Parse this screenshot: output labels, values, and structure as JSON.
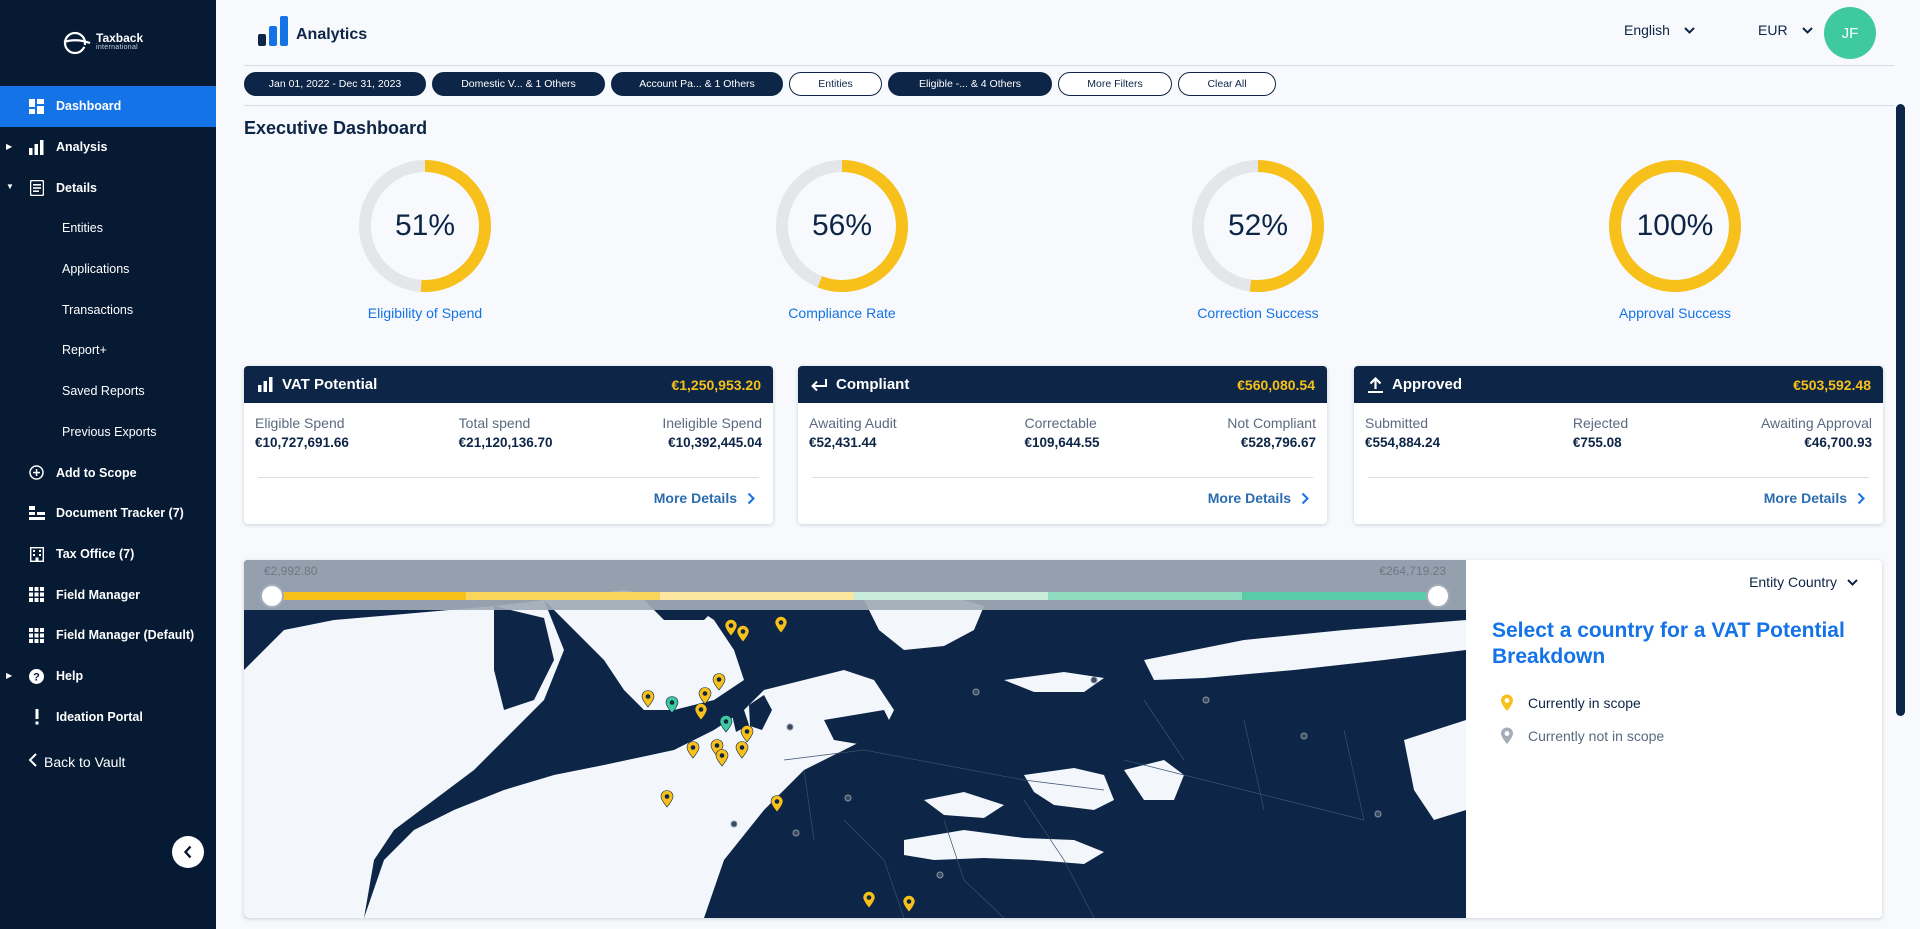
{
  "brand": {
    "line1": "Taxback",
    "line2": "international"
  },
  "sidebar": {
    "items": [
      {
        "label": "Dashboard",
        "icon": "dashboard-icon",
        "active": true
      },
      {
        "label": "Analysis",
        "icon": "bar-chart-icon",
        "caret": "right"
      },
      {
        "label": "Details",
        "icon": "document-icon",
        "caret": "down"
      },
      {
        "label": "Entities",
        "sub": true
      },
      {
        "label": "Applications",
        "sub": true
      },
      {
        "label": "Transactions",
        "sub": true
      },
      {
        "label": "Report+",
        "sub": true
      },
      {
        "label": "Saved Reports",
        "sub": true
      },
      {
        "label": "Previous Exports",
        "sub": true
      },
      {
        "label": "Add to Scope",
        "icon": "plus-circle-icon"
      },
      {
        "label": "Document Tracker (7)",
        "icon": "tracker-icon"
      },
      {
        "label": "Tax Office (7)",
        "icon": "building-icon"
      },
      {
        "label": "Field Manager",
        "icon": "grid-icon"
      },
      {
        "label": "Field Manager (Default)",
        "icon": "grid-icon"
      },
      {
        "label": "Help",
        "icon": "help-icon",
        "caret": "right"
      },
      {
        "label": "Ideation Portal",
        "icon": "exclamation-icon"
      }
    ],
    "back_label": "Back to Vault"
  },
  "header": {
    "title": "Analytics",
    "language": "English",
    "currency": "EUR",
    "user_initials": "JF"
  },
  "filters": [
    {
      "label": "Jan 01, 2022 - Dec 31, 2023",
      "active": true
    },
    {
      "label": "Domestic V... & 1 Others",
      "active": true
    },
    {
      "label": "Account Pa... & 1 Others",
      "active": true
    },
    {
      "label": "Entities",
      "active": false
    },
    {
      "label": "Eligible -... & 4 Others",
      "active": true
    },
    {
      "label": "More Filters",
      "active": false
    },
    {
      "label": "Clear All",
      "active": false
    }
  ],
  "page_title": "Executive Dashboard",
  "gauges": [
    {
      "value": 51,
      "label": "Eligibility of Spend",
      "display": "51%"
    },
    {
      "value": 56,
      "label": "Compliance Rate",
      "display": "56%"
    },
    {
      "value": 52,
      "label": "Correction Success",
      "display": "52%"
    },
    {
      "value": 100,
      "label": "Approval Success",
      "display": "100%"
    }
  ],
  "cards": [
    {
      "title": "VAT Potential",
      "amount": "€1,250,953.20",
      "icon": "bar-chart-icon",
      "metrics": [
        {
          "label": "Eligible Spend",
          "value": "€10,727,691.66"
        },
        {
          "label": "Total spend",
          "value": "€21,120,136.70"
        },
        {
          "label": "Ineligible Spend",
          "value": "€10,392,445.04"
        }
      ],
      "more": "More Details"
    },
    {
      "title": "Compliant",
      "amount": "€560,080.54",
      "icon": "return-arrow-icon",
      "metrics": [
        {
          "label": "Awaiting Audit",
          "value": "€52,431.44"
        },
        {
          "label": "Correctable",
          "value": "€109,644.55"
        },
        {
          "label": "Not Compliant",
          "value": "€528,796.67"
        }
      ],
      "more": "More Details"
    },
    {
      "title": "Approved",
      "amount": "€503,592.48",
      "icon": "upload-icon",
      "metrics": [
        {
          "label": "Submitted",
          "value": "€554,884.24"
        },
        {
          "label": "Rejected",
          "value": "€755.08"
        },
        {
          "label": "Awaiting Approval",
          "value": "€46,700.93"
        }
      ],
      "more": "More Details"
    }
  ],
  "map": {
    "range_min": "€2,992.80",
    "range_max": "€264,719.23",
    "scale_colors": [
      "#f7c01a",
      "#f9d55c",
      "#fbe7a0",
      "#c8eedb",
      "#8fdcc0",
      "#5bcaa6"
    ],
    "group_by": "Entity Country",
    "prompt": "Select a country for a VAT Potential Breakdown",
    "legend": [
      {
        "label": "Currently in scope",
        "color": "#f7c01a"
      },
      {
        "label": "Currently not in scope",
        "color": "#a4acb8"
      }
    ],
    "colors": {
      "ocean": "#f3f7fc",
      "land": "#0d2546"
    }
  }
}
